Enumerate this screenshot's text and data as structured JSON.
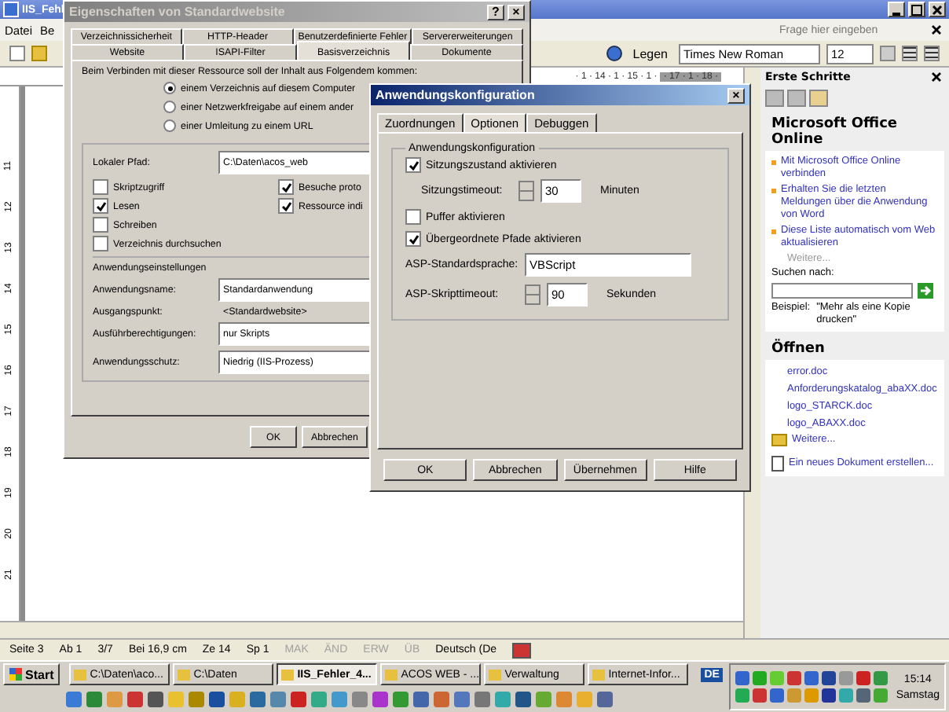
{
  "word": {
    "title": "IIS_Fehl",
    "menu": [
      "Datei",
      "Be"
    ],
    "help_placeholder": "Frage hier eingeben",
    "toolbar": {
      "button": "Legen",
      "font": "Times New Roman",
      "size": "12"
    },
    "ruler": [
      "· 1 · 14 · 1 · 15 · 1 ·",
      "· 17 · 1 · 18 ·"
    ],
    "vruler": [
      "11",
      "12",
      "13",
      "14",
      "15",
      "16",
      "17",
      "18",
      "19",
      "20",
      "21"
    ],
    "status_bar": [
      {
        "text": "Seite 3",
        "disabled": false
      },
      {
        "text": "Ab 1",
        "disabled": false
      },
      {
        "text": "3/7",
        "disabled": false
      },
      {
        "text": "Bei 16,9 cm",
        "disabled": false
      },
      {
        "text": "Ze 14",
        "disabled": false
      },
      {
        "text": "Sp 1",
        "disabled": false
      },
      {
        "text": "MAK",
        "disabled": true
      },
      {
        "text": "ÄND",
        "disabled": true
      },
      {
        "text": "ERW",
        "disabled": true
      },
      {
        "text": "ÜB",
        "disabled": true
      },
      {
        "text": "Deutsch (De",
        "disabled": false
      }
    ]
  },
  "task_pane": {
    "title": "Erste Schritte",
    "section": "Microsoft Office Online",
    "bullets": [
      "Mit Microsoft Office Online verbinden",
      "Erhalten Sie die letzten Meldungen über die Anwendung von Word",
      "Diese Liste automatisch vom Web aktualisieren"
    ],
    "more": "Weitere...",
    "search_label": "Suchen nach:",
    "example_label": "Beispiel:",
    "example": "\"Mehr als eine Kopie drucken\"",
    "open_title": "Öffnen",
    "files": [
      "error.doc",
      "Anforderungskatalog_abaXX.doc",
      "logo_STARCK.doc",
      "logo_ABAXX.doc"
    ],
    "open_more": "Weitere...",
    "new_doc": "Ein neues Dokument erstellen..."
  },
  "dialog1": {
    "title": "Eigenschaften von Standardwebsite",
    "help": "?",
    "close": "×",
    "tabs_back": [
      {
        "label": "Verzeichnissicherheit",
        "selected": false
      },
      {
        "label": "HTTP-Header",
        "selected": false
      },
      {
        "label": "Benutzerdefinierte Fehler",
        "selected": false
      },
      {
        "label": "Servererweiterungen",
        "selected": false
      }
    ],
    "tabs_front": [
      {
        "label": "Website",
        "selected": false
      },
      {
        "label": "ISAPI-Filter",
        "selected": false
      },
      {
        "label": "Basisverzeichnis",
        "selected": true
      },
      {
        "label": "Dokumente",
        "selected": false
      }
    ],
    "intro": "Beim Verbinden mit dieser Ressource soll der Inhalt aus Folgendem kommen:",
    "radios": [
      {
        "label": "einem Verzeichnis auf diesem Computer",
        "selected": true
      },
      {
        "label": "einer Netzwerkfreigabe auf einem ander",
        "selected": false
      },
      {
        "label": "einer Umleitung zu einem URL",
        "selected": false
      }
    ],
    "path_label": "Lokaler Pfad:",
    "path": "C:\\Daten\\acos_web",
    "checks_left": [
      {
        "label": "Skriptzugriff",
        "checked": false
      },
      {
        "label": "Lesen",
        "checked": true
      },
      {
        "label": "Schreiben",
        "checked": false
      },
      {
        "label": "Verzeichnis durchsuchen",
        "checked": false
      }
    ],
    "checks_right": [
      {
        "label": "Besuche proto",
        "checked": true
      },
      {
        "label": "Ressource indi",
        "checked": true
      }
    ],
    "app_settings": "Anwendungseinstellungen",
    "fields": [
      {
        "label": "Anwendungsname:",
        "value": "Standardanwendung",
        "kind": "input"
      },
      {
        "label": "Ausgangspunkt:",
        "value": "<Standardwebsite>",
        "kind": "text"
      },
      {
        "label": "Ausführberechtigungen:",
        "value": "nur Skripts",
        "kind": "input"
      },
      {
        "label": "Anwendungsschutz:",
        "value": "Niedrig (IIS-Prozess)",
        "kind": "input"
      }
    ],
    "buttons": [
      "OK",
      "Abbrechen"
    ]
  },
  "dialog2": {
    "title": "Anwendungskonfiguration",
    "close": "×",
    "tabs": [
      {
        "label": "Zuordnungen",
        "selected": false
      },
      {
        "label": "Optionen",
        "selected": true
      },
      {
        "label": "Debuggen",
        "selected": false
      }
    ],
    "group": "Anwendungskonfiguration",
    "session": {
      "label": "Sitzungszustand aktivieren",
      "checked": true
    },
    "timeout": {
      "label": "Sitzungstimeout:",
      "value": "30",
      "unit": "Minuten"
    },
    "buffer": {
      "label": "Puffer aktivieren",
      "checked": false
    },
    "parent_paths": {
      "label": "Übergeordnete Pfade aktivieren",
      "checked": true
    },
    "language": {
      "label": "ASP-Standardsprache:",
      "value": "VBScript"
    },
    "script_timeout": {
      "label": "ASP-Skripttimeout:",
      "value": "90",
      "unit": "Sekunden"
    },
    "buttons": [
      "OK",
      "Abbrechen",
      "Übernehmen",
      "Hilfe"
    ]
  },
  "taskbar": {
    "start": "Start",
    "tasks": [
      {
        "label": "C:\\Daten\\aco...",
        "selected": false
      },
      {
        "label": "C:\\Daten",
        "selected": false
      },
      {
        "label": "IIS_Fehler_4...",
        "selected": true
      },
      {
        "label": "ACOS WEB - ...",
        "selected": false
      },
      {
        "label": "Verwaltung",
        "selected": false
      },
      {
        "label": "Internet-Infor...",
        "selected": false
      }
    ],
    "language": "DE",
    "time": "15:14",
    "day": "Samstag"
  }
}
